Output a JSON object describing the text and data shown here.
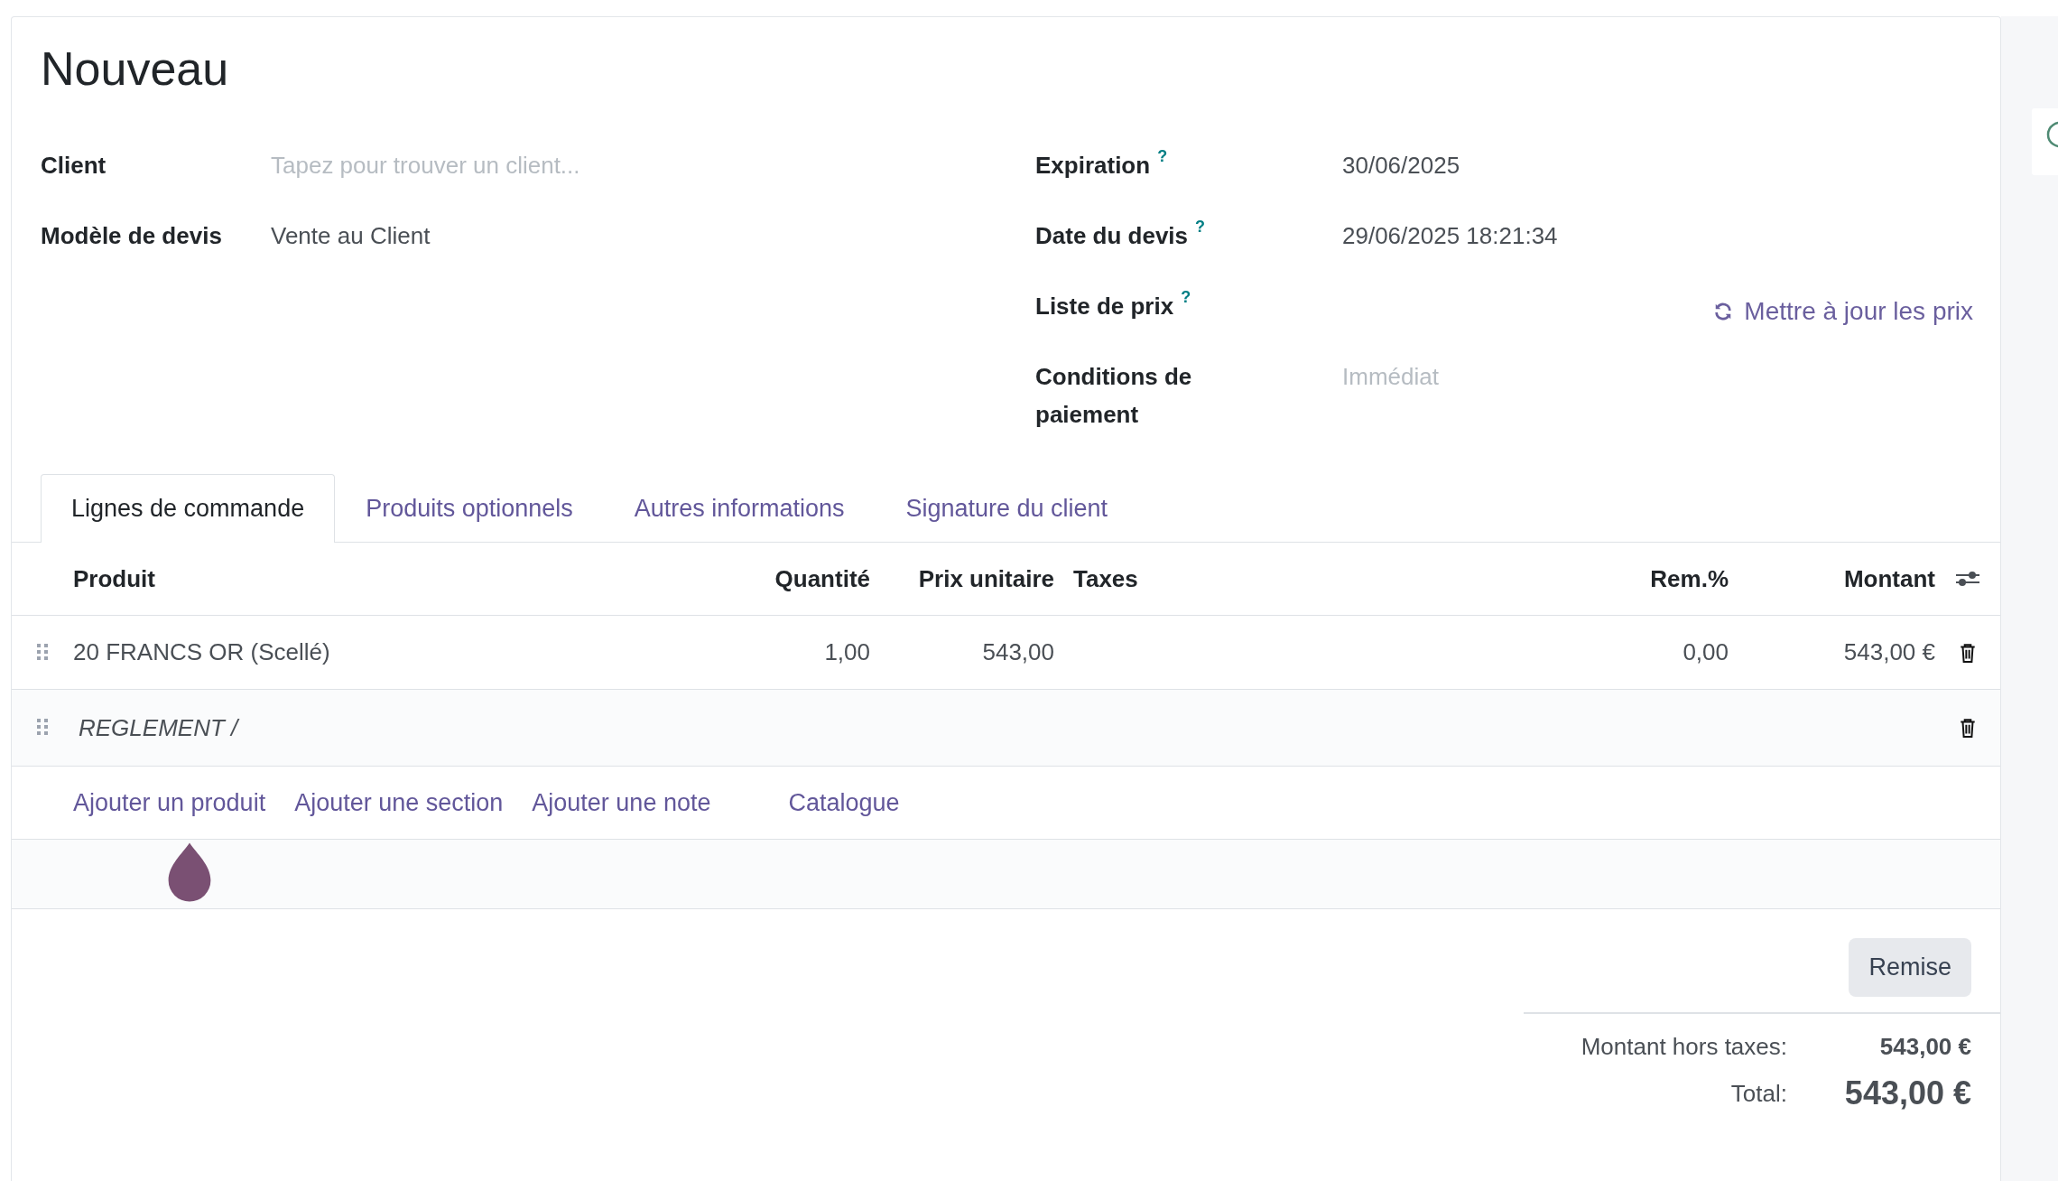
{
  "title": "Nouveau",
  "fields_left": [
    {
      "label": "Client",
      "placeholder": "Tapez pour trouver un client..."
    },
    {
      "label": "Modèle de devis",
      "value": "Vente au Client"
    }
  ],
  "fields_right": [
    {
      "label": "Expiration",
      "help": "?",
      "value": "30/06/2025"
    },
    {
      "label": "Date du devis",
      "help": "?",
      "value": "29/06/2025 18:21:34"
    },
    {
      "label": "Liste de prix",
      "help": "?",
      "action": "Mettre à jour les prix"
    },
    {
      "label": "Conditions de paiement",
      "placeholder": "Immédiat"
    }
  ],
  "tabs": [
    {
      "label": "Lignes de commande",
      "selected": true
    },
    {
      "label": "Produits optionnels",
      "selected": false
    },
    {
      "label": "Autres informations",
      "selected": false
    },
    {
      "label": "Signature du client",
      "selected": false
    }
  ],
  "table": {
    "columns": [
      {
        "kind": "text",
        "label": "Produit"
      },
      {
        "kind": "number",
        "label": "Quantité"
      },
      {
        "kind": "number",
        "label": "Prix unitaire"
      },
      {
        "kind": "text",
        "label": "Taxes"
      },
      {
        "kind": "number",
        "label": "Rem.%"
      },
      {
        "kind": "number",
        "label": "Montant"
      }
    ],
    "rows": [
      {
        "kind": "product",
        "product": "20 FRANCS OR (Scellé)",
        "quantity": "1,00",
        "unit_price": "543,00",
        "discount": "0,00",
        "amount": "543,00 €"
      },
      {
        "kind": "note",
        "product": "REGLEMENT /"
      }
    ],
    "add_links": [
      "Ajouter un produit",
      "Ajouter une section",
      "Ajouter une note",
      "Catalogue"
    ]
  },
  "discount_button": "Remise",
  "totals": [
    {
      "kind": "subtotal",
      "label": "Montant hors taxes:",
      "value": "543,00 €"
    },
    {
      "kind": "total",
      "label": "Total:",
      "value": "543,00 €"
    }
  ]
}
